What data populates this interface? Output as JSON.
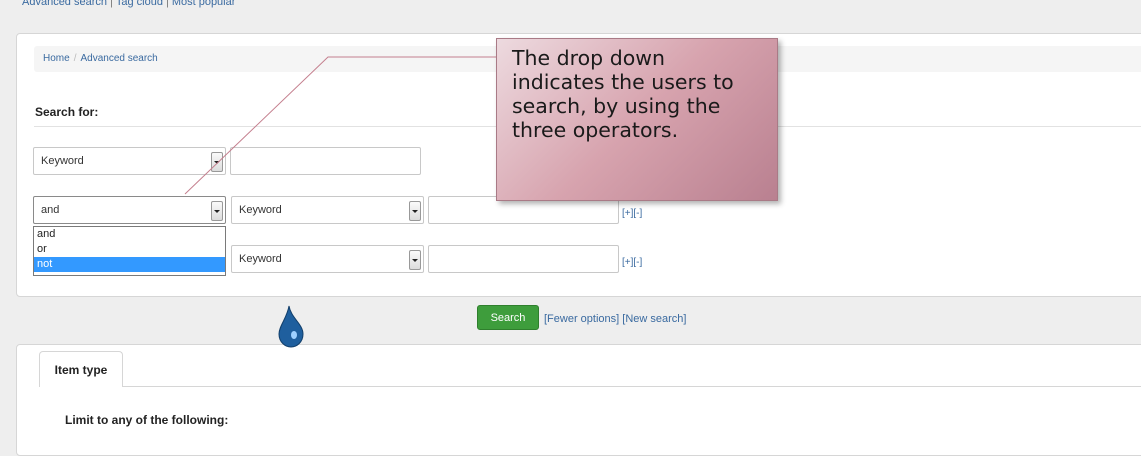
{
  "top_links": [
    "Advanced search",
    "Tag cloud",
    "Most popular"
  ],
  "breadcrumb": [
    "Home",
    "Advanced search"
  ],
  "search_heading": "Search for:",
  "rows": [
    {
      "field": "Keyword"
    },
    {
      "operator": "and",
      "field": "Keyword",
      "add": "[+]",
      "remove": "[-]"
    },
    {
      "field": "Keyword",
      "add": "[+]",
      "remove": "[-]"
    }
  ],
  "operator_options": [
    {
      "label": "and",
      "selected": false
    },
    {
      "label": "or",
      "selected": false
    },
    {
      "label": "not",
      "selected": true
    }
  ],
  "search_button": "Search",
  "fewer_options": "[Fewer options]",
  "new_search": "[New search]",
  "tab_item_type": "Item type",
  "limit_heading": "Limit to any of the following:",
  "callout_text": "The drop down indicates the users to search, by using the three operators.",
  "colors": {
    "search_button": "#3e9d3c",
    "link": "#3a6aa0",
    "selected_option": "#3399ff",
    "callout": "#d7a3ae"
  }
}
